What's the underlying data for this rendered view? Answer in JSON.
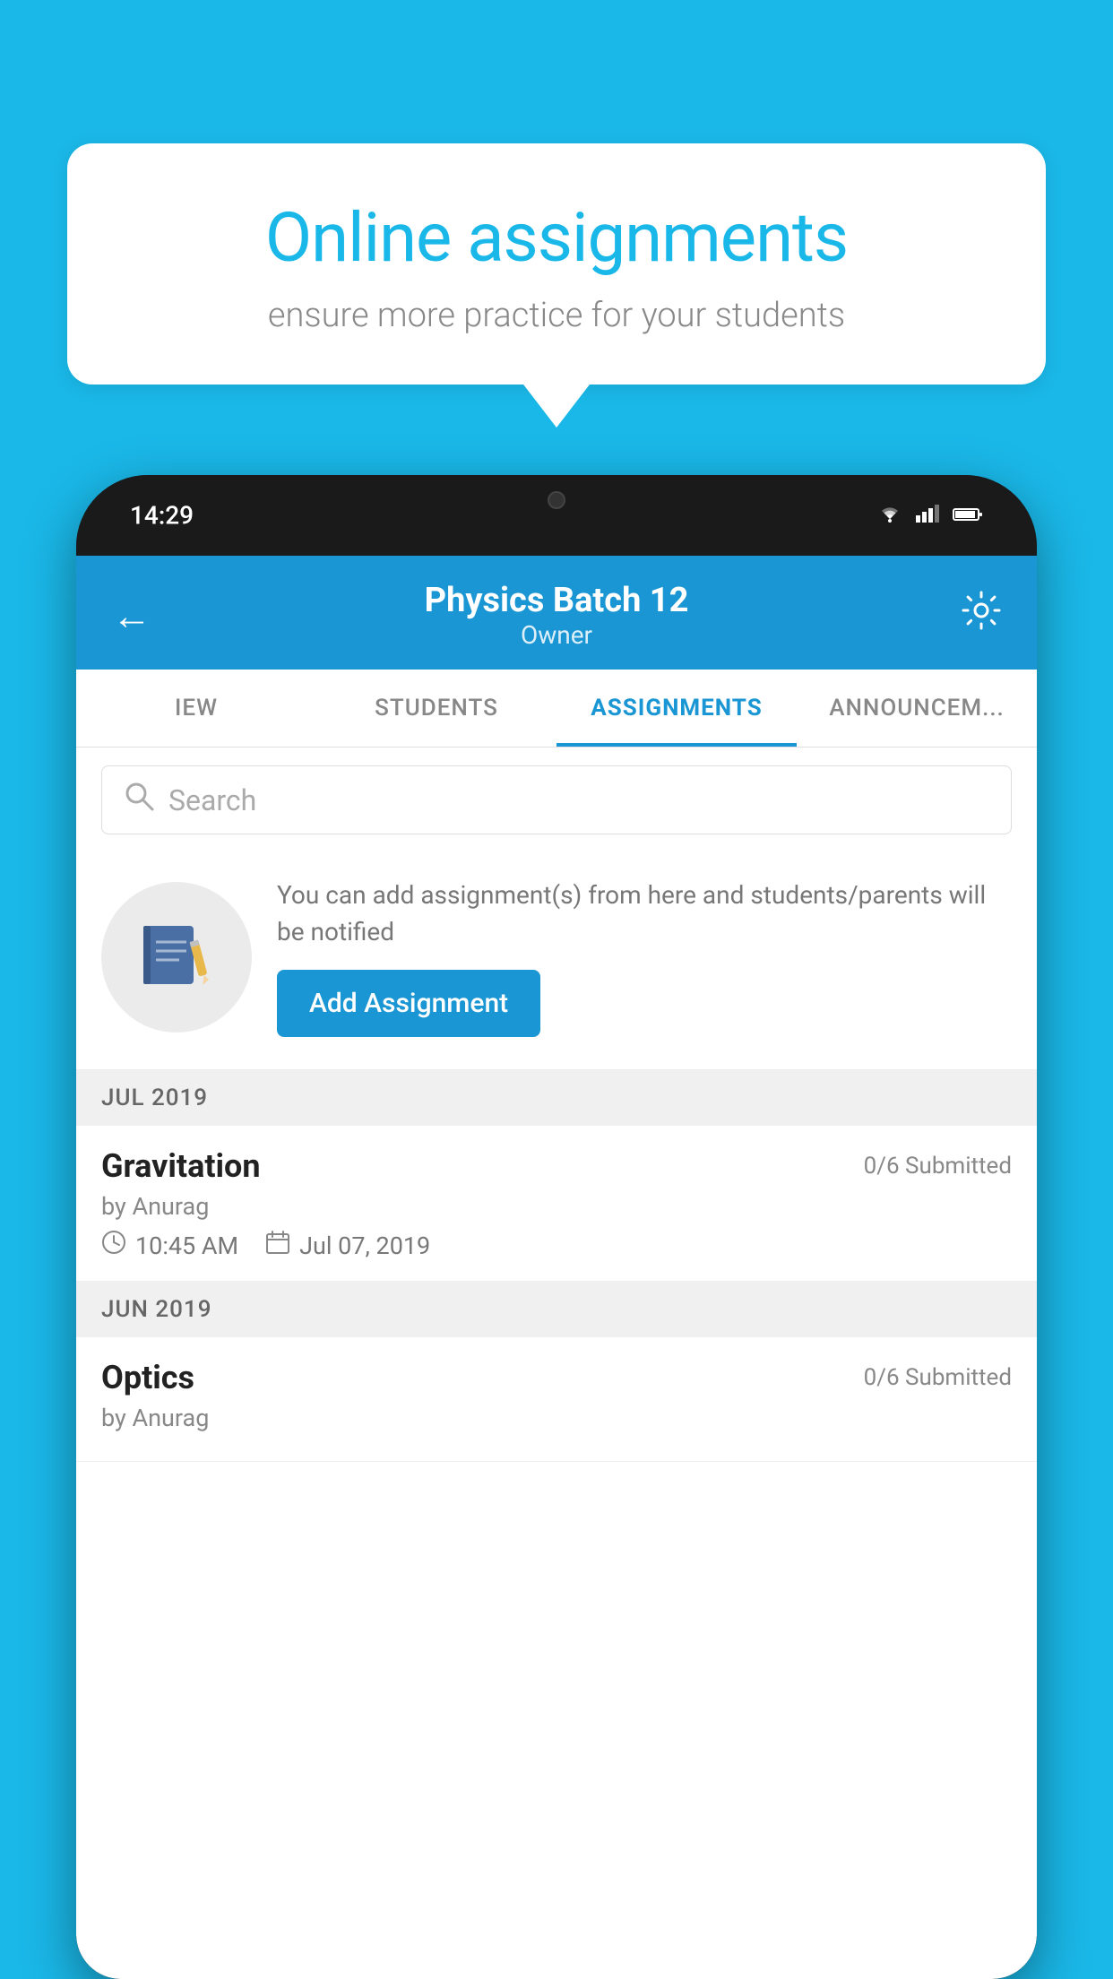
{
  "page": {
    "background_color": "#1ab8e8"
  },
  "speech_bubble": {
    "title": "Online assignments",
    "subtitle": "ensure more practice for your students"
  },
  "phone": {
    "status_bar": {
      "time": "14:29",
      "wifi": "▾",
      "signal": "▲",
      "battery": "▮"
    },
    "header": {
      "title": "Physics Batch 12",
      "subtitle": "Owner",
      "back_label": "←",
      "settings_label": "⚙"
    },
    "tabs": [
      {
        "id": "view",
        "label": "IEW"
      },
      {
        "id": "students",
        "label": "STUDENTS"
      },
      {
        "id": "assignments",
        "label": "ASSIGNMENTS",
        "active": true
      },
      {
        "id": "announcements",
        "label": "ANNOUNCEM..."
      }
    ],
    "search": {
      "placeholder": "Search"
    },
    "info_card": {
      "description": "You can add assignment(s) from here and students/parents will be notified",
      "button_label": "Add Assignment"
    },
    "assignment_groups": [
      {
        "month_label": "JUL 2019",
        "assignments": [
          {
            "name": "Gravitation",
            "submitted": "0/6 Submitted",
            "author": "by Anurag",
            "time": "10:45 AM",
            "date": "Jul 07, 2019"
          }
        ]
      },
      {
        "month_label": "JUN 2019",
        "assignments": [
          {
            "name": "Optics",
            "submitted": "0/6 Submitted",
            "author": "by Anurag",
            "time": "",
            "date": ""
          }
        ]
      }
    ]
  }
}
